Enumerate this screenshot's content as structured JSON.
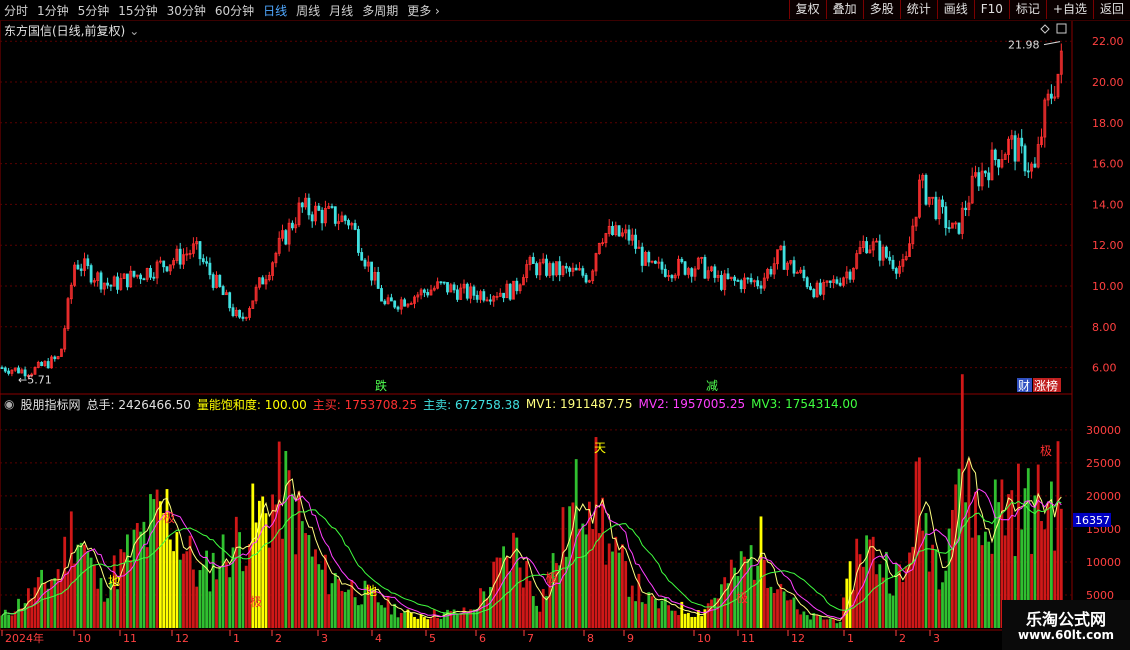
{
  "toolbar": {
    "periods": [
      "分时",
      "1分钟",
      "5分钟",
      "15分钟",
      "30分钟",
      "60分钟",
      "日线",
      "周线",
      "月线",
      "多周期",
      "更多"
    ],
    "active": "日线",
    "more_chevron": "chevron-right-icon",
    "buttons": [
      "复权",
      "叠加",
      "多股",
      "统计",
      "画线",
      "F10",
      "标记",
      "+自选",
      "返回"
    ]
  },
  "stock": {
    "title": "东方国信(日线,前复权)",
    "dropdown_icon": "chevron-down-icon"
  },
  "price_axis": {
    "ticks": [
      "22.00",
      "20.00",
      "18.00",
      "16.00",
      "14.00",
      "12.00",
      "10.00",
      "8.00",
      "6.00"
    ],
    "min": 5.0,
    "max": 22.5
  },
  "price_marks": {
    "high": "21.98",
    "low": "5.71"
  },
  "event_labels": [
    {
      "text": "跌",
      "color": "#50ff50"
    },
    {
      "text": "减",
      "color": "#50ff50"
    },
    {
      "text": "财",
      "color": "#ffffff",
      "bg": "#3050c0"
    },
    {
      "text": "涨榜",
      "color": "#ffffff",
      "bg": "#c02020"
    }
  ],
  "indicator": {
    "name": "股朋指标网",
    "fields": [
      {
        "label": "总手:",
        "value": "2426466.50",
        "color": "#e0e0e0"
      },
      {
        "label": "量能饱和度:",
        "value": "100.00",
        "color": "#ffff00"
      },
      {
        "label": "主买:",
        "value": "1753708.25",
        "color": "#ff3030"
      },
      {
        "label": "主卖:",
        "value": "672758.38",
        "color": "#40e0e0"
      },
      {
        "label": "MV1:",
        "value": "1911487.75",
        "color": "#ffff80"
      },
      {
        "label": "MV2:",
        "value": "1957005.25",
        "color": "#ff40ff"
      },
      {
        "label": "MV3:",
        "value": "1754314.00",
        "color": "#40ff40"
      }
    ]
  },
  "volume_axis": {
    "ticks": [
      "30000",
      "25000",
      "20000",
      "15000",
      "10000",
      "5000"
    ],
    "min": 0,
    "max": 33000,
    "current": "16357"
  },
  "volume_signals": [
    {
      "text": "天",
      "color": "#ffff00"
    },
    {
      "text": "极",
      "color": "#ff3030"
    },
    {
      "text": "地",
      "color": "#ffff00"
    }
  ],
  "x_axis": {
    "labels": [
      "2024年",
      "10",
      "11",
      "12",
      "1",
      "2",
      "3",
      "4",
      "5",
      "6",
      "7",
      "8",
      "9",
      "10",
      "11",
      "12",
      "1",
      "2",
      "3"
    ]
  },
  "watermark": {
    "line1": "乐淘公式网",
    "line2": "www.60lt.com"
  },
  "colors": {
    "up": "#ff3030",
    "down": "#40e0e0",
    "grid": "#5a0000",
    "axis": "#8a0000",
    "vol_up": "#d01818",
    "vol_down": "#30c030",
    "vol_hot": "#ffff00"
  }
}
